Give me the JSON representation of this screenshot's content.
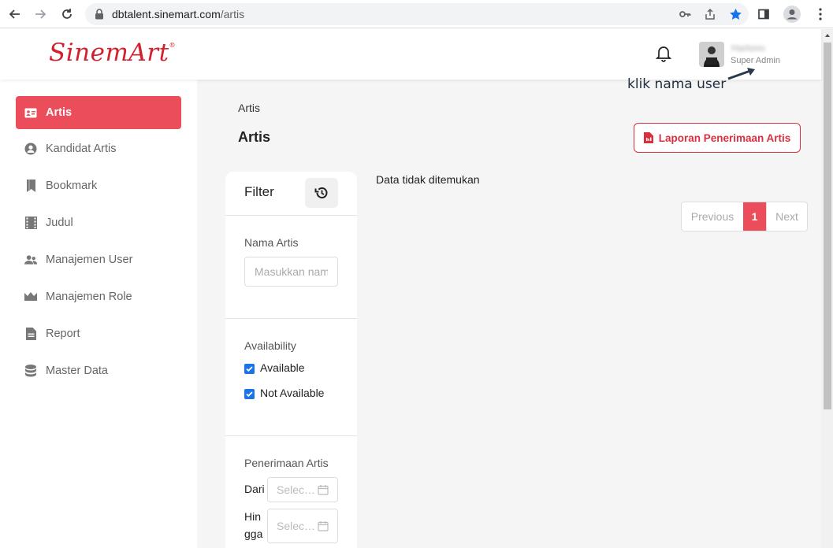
{
  "browser": {
    "url_host": "dbtalent.sinemart.com",
    "url_path": "/artis"
  },
  "header": {
    "logo_text": "SinemArt",
    "user_name": "Hartono",
    "user_role": "Super Admin"
  },
  "annotation": {
    "text": "klik nama user"
  },
  "sidebar": {
    "items": [
      {
        "label": "Artis",
        "icon": "id-card-icon",
        "active": true
      },
      {
        "label": "Kandidat Artis",
        "icon": "user-circle-icon"
      },
      {
        "label": "Bookmark",
        "icon": "bookmark-icon"
      },
      {
        "label": "Judul",
        "icon": "film-icon"
      },
      {
        "label": "Manajemen User",
        "icon": "users-icon"
      },
      {
        "label": "Manajemen Role",
        "icon": "crown-icon"
      },
      {
        "label": "Report",
        "icon": "file-icon"
      },
      {
        "label": "Master Data",
        "icon": "database-icon"
      }
    ]
  },
  "main": {
    "breadcrumb": "Artis",
    "title": "Artis",
    "report_button": "Laporan Penerimaan Artis",
    "empty_message": "Data tidak ditemukan",
    "pagination": {
      "previous": "Previous",
      "current": "1",
      "next": "Next"
    }
  },
  "filter": {
    "title": "Filter",
    "name_label": "Nama Artis",
    "name_placeholder": "Masukkan nama artis",
    "availability_label": "Availability",
    "available": "Available",
    "not_available": "Not Available",
    "received_label": "Penerimaan Artis",
    "from_label": "Dari",
    "to_label_line1": "Hin",
    "to_label_line2": "gga",
    "date_placeholder": "Selec…"
  },
  "colors": {
    "accent": "#ec4d5b",
    "brand_red": "#d3202f",
    "checkbox_blue": "#1a73e8"
  }
}
